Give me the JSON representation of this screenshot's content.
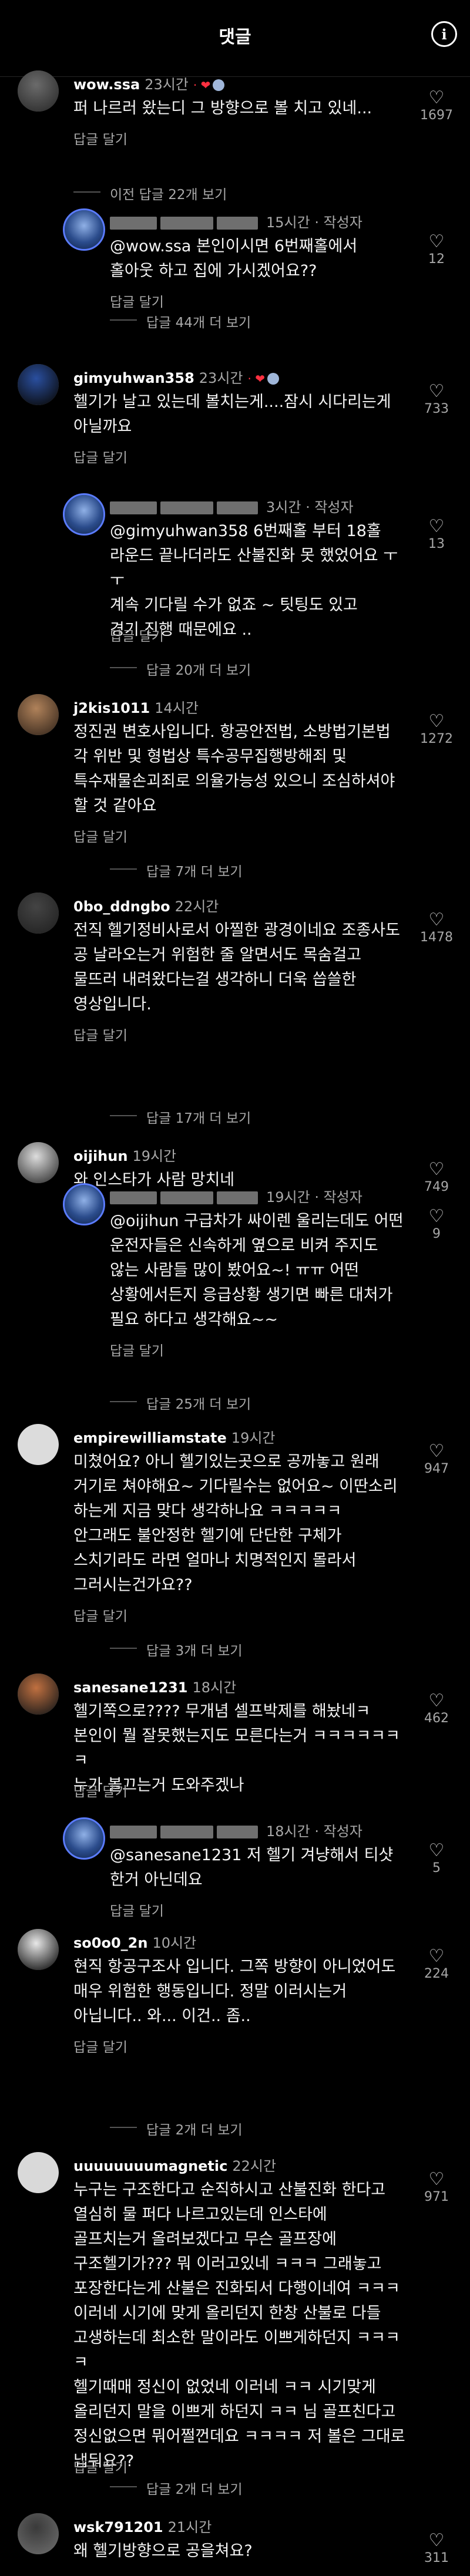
{
  "header": {
    "title": "댓글",
    "info_icon": "i"
  },
  "comments": [
    {
      "username": "wow.ssa",
      "time": "23시간",
      "has_heart": true,
      "text": "퍼 나르러 왔는디 그 방향으로 볼 치고 있네...",
      "reply_label": "답글 달기",
      "likes": "1697",
      "view_more": "이전 답글 22개 보기"
    },
    {
      "is_reply": true,
      "time": "15시간",
      "author_tag": "작성자",
      "text": "@wow.ssa 본인이시면 6번째홀에서\n홀아웃 하고 집에 가시겠어요??",
      "reply_label": "답글 달기",
      "likes": "12",
      "view_more": "답글 44개 더 보기"
    },
    {
      "username": "gimyuhwan358",
      "time": "23시간",
      "has_heart": true,
      "text": "헬기가 날고 있는데 볼치는게....잠시 시다리는게\n아닐까요",
      "reply_label": "답글 달기",
      "likes": "733"
    },
    {
      "is_reply": true,
      "time": "3시간",
      "author_tag": "작성자",
      "text": "@gimyuhwan358 6번째홀 부터 18홀\n라운드 끝나더라도 산불진화 못 했었어요 ㅜㅜ\n계속 기다릴 수가 없죠 ~ 팃팅도 있고\n경기 진행 때문에요 ..",
      "reply_label": "답글 달기",
      "likes": "13",
      "view_more": "답글 20개 더 보기"
    },
    {
      "username": "j2kis1011",
      "time": "14시간",
      "verified": true,
      "text": "정진권 변호사입니다. 항공안전법, 소방법기본법\n각 위반 및 형법상 특수공무집행방해죄 및\n특수재물손괴죄로 의율가능성 있으니 조심하셔야\n할 것 같아요",
      "reply_label": "답글 달기",
      "likes": "1272",
      "view_more": "답글 7개 더 보기"
    },
    {
      "username": "0bo_ddngbo",
      "time": "22시간",
      "text": "전직 헬기정비사로서 아찔한 광경이네요 조종사도\n공 날라오는거 위험한 줄 알면서도 목숨걸고\n물뜨러 내려왔다는걸 생각하니 더욱 씁쓸한\n영상입니다.",
      "reply_label": "답글 달기",
      "likes": "1478",
      "view_more": "답글 17개 더 보기"
    },
    {
      "username": "oijihun",
      "time": "19시간",
      "text": "와 인스타가 사람 망치네",
      "reply_label": "",
      "likes": "749"
    },
    {
      "is_reply": true,
      "time": "19시간",
      "author_tag": "작성자",
      "text": "@oijihun 구급차가 싸이렌 울리는데도 어떤\n운전자들은 신속하게 옆으로 비켜 주지도\n않는 사람들 많이 봤어요~! ㅠㅠ 어떤\n상황에서든지 응급상황 생기면 빠른 대처가\n필요 하다고 생각해요~~",
      "reply_label": "답글 달기",
      "likes": "9",
      "view_more": "답글 25개 더 보기"
    },
    {
      "username": "empirewilliamstate",
      "time": "19시간",
      "text": "미쳤어요? 아니 헬기있는곳으로 공까놓고 원래\n거기로 쳐야해요~ 기다릴수는 없어요~ 이딴소리\n하는게 지금 맞다 생각하나요 ㅋㅋㅋㅋㅋ\n안그래도 불안정한 헬기에 단단한 구체가\n스치기라도 라면 얼마나 치명적인지 몰라서\n그러시는건가요??",
      "reply_label": "답글 달기",
      "likes": "947",
      "view_more": "답글 3개 더 보기"
    },
    {
      "username": "sanesane1231",
      "time": "18시간",
      "text": "헬기쪽으로???? 무개념 셀프박제를 해놨네ㅋ\n본인이 뭘 잘못했는지도 모른다는거 ㅋㅋㅋㅋㅋㅋㅋ\n누가 볼끄는거 도와주겠나",
      "reply_label": "답글 달기",
      "likes": "462"
    },
    {
      "is_reply": true,
      "time": "18시간",
      "author_tag": "작성자",
      "text": "@sanesane1231 저 헬기 겨냥해서 티샷\n한거 아닌데요",
      "reply_label": "답글 달기",
      "likes": "5"
    },
    {
      "username": "so0o0_2n",
      "time": "10시간",
      "text": "현직 항공구조사 입니다. 그쪽 방향이 아니었어도\n매우 위험한 행동입니다. 정말 이러시는거\n아닙니다.. 와... 이건.. 좀..",
      "reply_label": "답글 달기",
      "likes": "224",
      "view_more": "답글 2개 더 보기"
    },
    {
      "username": "uuuuuuuumagnetic",
      "time": "22시간",
      "text": "누구는 구조한다고 순직하시고 산불진화 한다고\n열심히 물 퍼다 나르고있는데 인스타에\n골프치는거 올려보겠다고 무슨 골프장에\n구조헬기가??? 뭐 이러고있네 ㅋㅋㅋ 그래놓고\n포장한다는게 산불은 진화되서 다행이네여 ㅋㅋㅋ\n이러네 시기에 맞게 올리던지 한창 산불로 다들\n고생하는데 최소한 말이라도 이쁘게하던지 ㅋㅋㅋㅋ\n헬기때매 정신이 없었네 이러네 ㅋㅋ 시기맞게\n올리던지 말을 이쁘게 하던지 ㅋㅋ 님 골프친다고\n정신없으면 뭐어쩔껀데요 ㅋㅋㅋㅋ 저 볼은 그대로\n냅둬요??",
      "reply_label": "답글 달기",
      "likes": "971",
      "view_more": "답글 2개 더 보기"
    },
    {
      "username": "wsk791201",
      "time": "21시간",
      "text": "왜 헬기방향으로 공을쳐요?",
      "reply_label": "",
      "likes": "311"
    }
  ]
}
